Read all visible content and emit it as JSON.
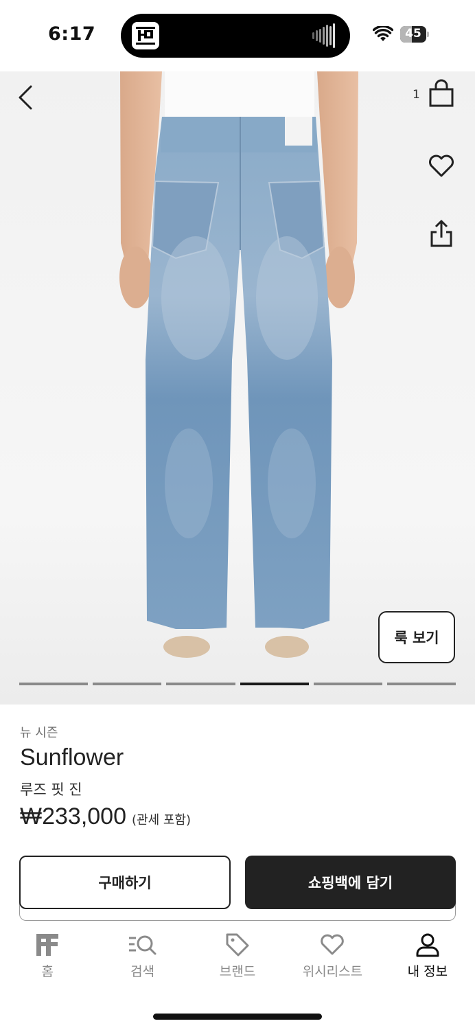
{
  "status_bar": {
    "time": "6:17",
    "battery_level": "45",
    "battery_fraction": 0.45,
    "icons": [
      "app-logo-icon",
      "audio-wave-icon",
      "wifi-icon",
      "battery-icon"
    ]
  },
  "gallery": {
    "cart_count": "1",
    "look_button_label": "룩 보기",
    "image_count": 6,
    "active_index": 3,
    "icons": [
      "back-chevron-icon",
      "shopping-bag-icon",
      "heart-icon",
      "share-icon"
    ]
  },
  "product": {
    "season_label": "뉴 시즌",
    "brand": "Sunflower",
    "name": "루즈 핏 진",
    "price": "₩233,000",
    "tax_note": "(관세 포함)"
  },
  "actions": {
    "buy_label": "구매하기",
    "add_to_bag_label": "쇼핑백에 담기"
  },
  "tab_bar": {
    "tabs": [
      {
        "label": "홈",
        "icon": "home-ff-icon",
        "active": false
      },
      {
        "label": "검색",
        "icon": "search-icon",
        "active": false
      },
      {
        "label": "브랜드",
        "icon": "tag-icon",
        "active": false
      },
      {
        "label": "위시리스트",
        "icon": "heart-icon",
        "active": false
      },
      {
        "label": "내 정보",
        "icon": "person-icon",
        "active": true
      }
    ]
  },
  "colors": {
    "text_dark": "#222222",
    "text_muted": "#8a8a8a",
    "denim": "#7fa3c4",
    "button_dark": "#222222"
  }
}
